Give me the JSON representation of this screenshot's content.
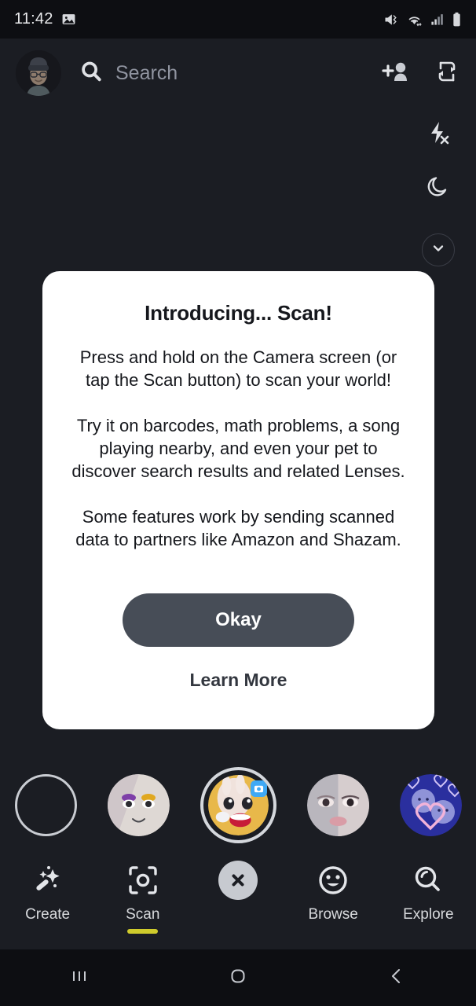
{
  "status_bar": {
    "time": "11:42",
    "left_icons": [
      {
        "name": "screenshot-notification-icon"
      }
    ],
    "right_icons": [
      {
        "name": "vibrate-mode-icon"
      },
      {
        "name": "wifi-icon"
      },
      {
        "name": "cellular-signal-icon"
      },
      {
        "name": "battery-icon"
      }
    ]
  },
  "top_bar": {
    "avatar_label": "Bitmoji profile",
    "search_placeholder": "Search",
    "search_value": "",
    "add_friend_label": "Add Friends",
    "flip_camera_label": "Flip Camera"
  },
  "side_controls": [
    {
      "name": "flip-camera-icon",
      "label": "Flip Camera"
    },
    {
      "name": "flash-off-icon",
      "label": "Flash Off"
    },
    {
      "name": "night-mode-icon",
      "label": "Night Mode"
    },
    {
      "name": "chevron-down-icon",
      "label": "More Options"
    }
  ],
  "modal": {
    "title": "Introducing... Scan!",
    "paragraphs": [
      "Press and hold on the Camera screen (or tap the Scan button) to scan your world!",
      "Try it on barcodes, math problems, a song playing nearby, and even your pet to discover search results and related Lenses.",
      "Some features work by sending scanned data to partners like Amazon and Shazam."
    ],
    "primary_button": "Okay",
    "secondary_button": "Learn More",
    "primary_button_color": "#474D57",
    "background_color": "#FFFFFF"
  },
  "carousel": {
    "lenses": [
      {
        "name": "lens-none",
        "selected": false,
        "type": "empty"
      },
      {
        "name": "lens-eyeshadow",
        "selected": false,
        "type": "thumbnail"
      },
      {
        "name": "lens-bunny-face",
        "selected": true,
        "type": "thumbnail",
        "badge": "camera-badge"
      },
      {
        "name": "lens-split-eyes",
        "selected": false,
        "type": "thumbnail"
      },
      {
        "name": "lens-hearts",
        "selected": false,
        "type": "thumbnail"
      }
    ]
  },
  "bottom_nav": {
    "accent_color": "#CFCB2C",
    "items": [
      {
        "label": "Create",
        "icon": "magic-wand-icon",
        "active": false
      },
      {
        "label": "Scan",
        "icon": "scan-frame-icon",
        "active": true
      },
      {
        "label": "",
        "icon": "close-x-icon",
        "active": false
      },
      {
        "label": "Browse",
        "icon": "smiley-face-icon",
        "active": false
      },
      {
        "label": "Explore",
        "icon": "magnifier-icon",
        "active": false
      }
    ]
  },
  "android_nav": {
    "buttons": [
      {
        "name": "recents-button",
        "icon": "recents-icon"
      },
      {
        "name": "home-button",
        "icon": "home-icon"
      },
      {
        "name": "back-button",
        "icon": "back-chevron-icon"
      }
    ]
  }
}
